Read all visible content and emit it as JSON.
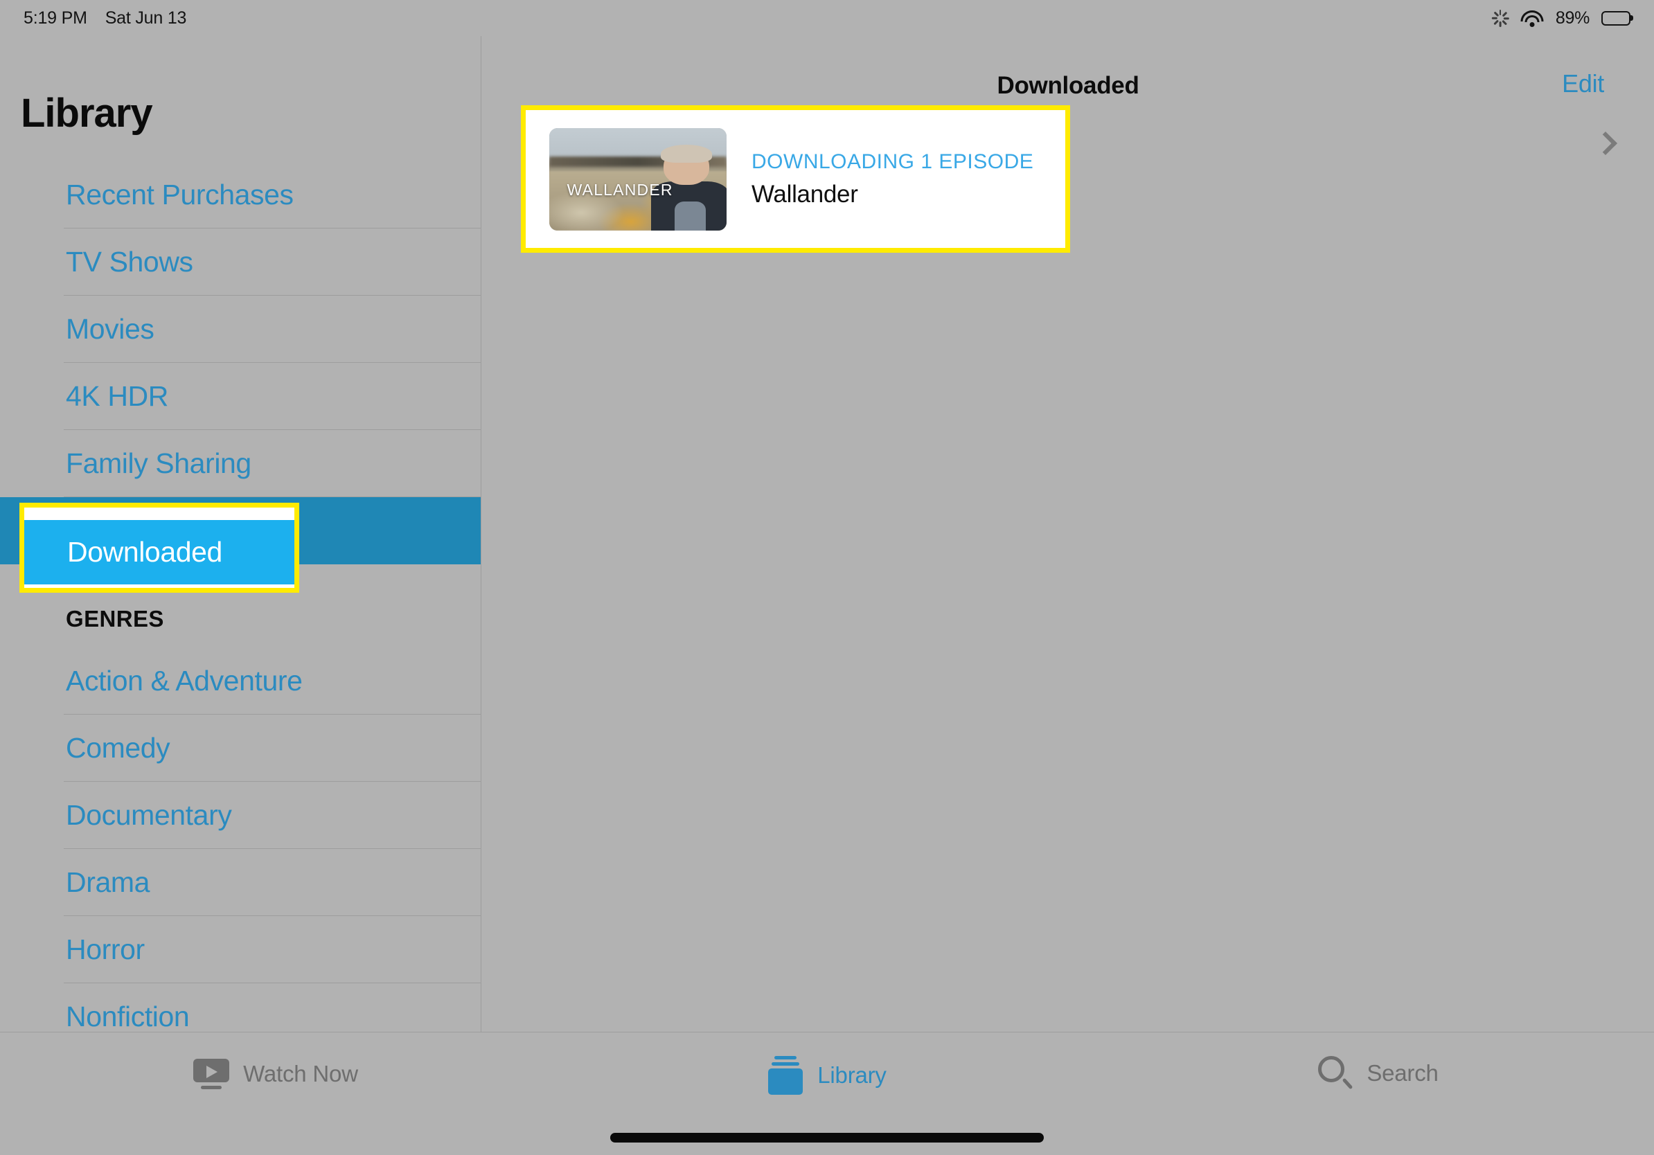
{
  "status_bar": {
    "time": "5:19 PM",
    "date": "Sat Jun 13",
    "battery_percent": "89%",
    "icons": [
      "activity-spinner-icon",
      "wifi-icon",
      "battery-icon"
    ]
  },
  "sidebar": {
    "title": "Library",
    "items": [
      {
        "label": "Recent Purchases",
        "selected": false
      },
      {
        "label": "TV Shows",
        "selected": false
      },
      {
        "label": "Movies",
        "selected": false
      },
      {
        "label": "4K HDR",
        "selected": false
      },
      {
        "label": "Family Sharing",
        "selected": false
      },
      {
        "label": "Downloaded",
        "selected": true
      }
    ],
    "genres_header": "GENRES",
    "genres": [
      {
        "label": "Action & Adventure"
      },
      {
        "label": "Comedy"
      },
      {
        "label": "Documentary"
      },
      {
        "label": "Drama"
      },
      {
        "label": "Horror"
      },
      {
        "label": "Nonfiction"
      }
    ]
  },
  "main": {
    "title": "Downloaded",
    "edit_label": "Edit",
    "row": {
      "eyebrow": "DOWNLOADING 1 EPISODE",
      "title": "Wallander",
      "thumbnail_label": "WALLANDER",
      "disclosure": "chevron-right-icon"
    }
  },
  "tab_bar": {
    "tabs": [
      {
        "label": "Watch Now",
        "icon": "watch-now-icon",
        "active": false
      },
      {
        "label": "Library",
        "icon": "library-icon",
        "active": true
      },
      {
        "label": "Search",
        "icon": "search-icon",
        "active": false
      }
    ]
  },
  "colors": {
    "background": "#b2b2b2",
    "link_blue": "#2b8bc0",
    "selected_row": "#1f87b5",
    "highlight_cyan": "#1cb0ee",
    "annotation_yellow": "#ffeb00",
    "eyebrow_blue": "#39a8e6"
  }
}
